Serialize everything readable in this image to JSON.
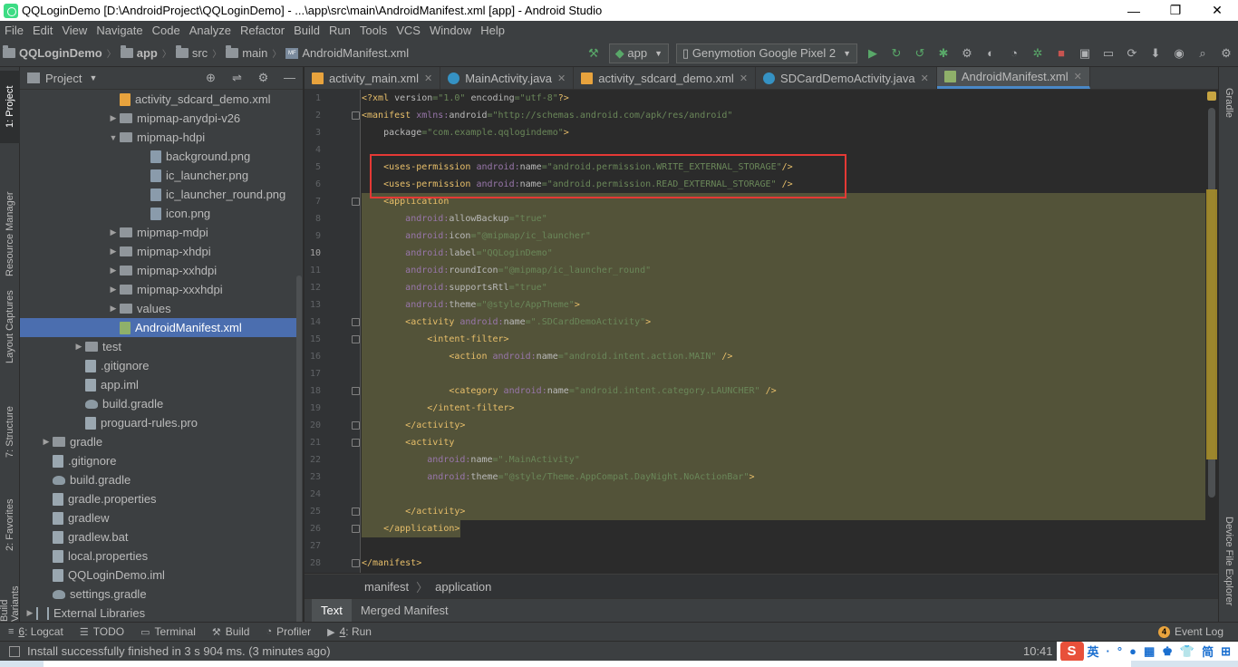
{
  "window": {
    "title": "QQLoginDemo [D:\\AndroidProject\\QQLoginDemo] - ...\\app\\src\\main\\AndroidManifest.xml [app] - Android Studio",
    "minimize": "—",
    "maximize": "❐",
    "close": "✕"
  },
  "menu": [
    "File",
    "Edit",
    "View",
    "Navigate",
    "Code",
    "Analyze",
    "Refactor",
    "Build",
    "Run",
    "Tools",
    "VCS",
    "Window",
    "Help"
  ],
  "nav": {
    "project": "QQLoginDemo",
    "module": "app",
    "src": "src",
    "main": "main",
    "file": "AndroidManifest.xml",
    "run_config": "app",
    "device": "Genymotion Google Pixel 2"
  },
  "left_stripe": {
    "project": "1: Project",
    "resource_manager": "Resource Manager",
    "layout_captures": "Layout Captures",
    "structure": "7: Structure",
    "favorites": "2: Favorites",
    "variants": "Build Variants"
  },
  "right_stripe": {
    "gradle": "Gradle",
    "device_file_explorer": "Device File Explorer"
  },
  "project_panel": {
    "title": "Project",
    "tree": [
      {
        "label": "activity_sdcard_demo.xml",
        "indent": 0,
        "icon": "xml-file-icon"
      },
      {
        "label": "mipmap-anydpi-v26",
        "indent": 0,
        "icon": "folder-icon",
        "arrow": "▶"
      },
      {
        "label": "mipmap-hdpi",
        "indent": 0,
        "icon": "folder-icon",
        "arrow": "▼"
      },
      {
        "label": "background.png",
        "indent": 1,
        "icon": "png-file-icon"
      },
      {
        "label": "ic_launcher.png",
        "indent": 1,
        "icon": "png-file-icon"
      },
      {
        "label": "ic_launcher_round.png",
        "indent": 1,
        "icon": "png-file-icon"
      },
      {
        "label": "icon.png",
        "indent": 1,
        "icon": "png-file-icon"
      },
      {
        "label": "mipmap-mdpi",
        "indent": 0,
        "icon": "folder-icon",
        "arrow": "▶"
      },
      {
        "label": "mipmap-xhdpi",
        "indent": 0,
        "icon": "folder-icon",
        "arrow": "▶"
      },
      {
        "label": "mipmap-xxhdpi",
        "indent": 0,
        "icon": "folder-icon",
        "arrow": "▶"
      },
      {
        "label": "mipmap-xxxhdpi",
        "indent": 0,
        "icon": "folder-icon",
        "arrow": "▶"
      },
      {
        "label": "values",
        "indent": 0,
        "icon": "folder-icon",
        "arrow": "▶"
      },
      {
        "label": "AndroidManifest.xml",
        "indent": -1,
        "icon": "manifest-icon",
        "selected": true
      },
      {
        "label": "test",
        "indent": -2,
        "icon": "folder-icon",
        "arrow": "▶"
      },
      {
        "label": ".gitignore",
        "indent": -2,
        "icon": "text-file-icon"
      },
      {
        "label": "app.iml",
        "indent": -2,
        "icon": "text-file-icon"
      },
      {
        "label": "build.gradle",
        "indent": -2,
        "icon": "gradle-icon"
      },
      {
        "label": "proguard-rules.pro",
        "indent": -2,
        "icon": "text-file-icon"
      },
      {
        "label": "gradle",
        "indent": -3,
        "icon": "folder-icon",
        "arrow": "▶"
      },
      {
        "label": ".gitignore",
        "indent": -3,
        "icon": "text-file-icon"
      },
      {
        "label": "build.gradle",
        "indent": -3,
        "icon": "gradle-icon"
      },
      {
        "label": "gradle.properties",
        "indent": -3,
        "icon": "text-file-icon"
      },
      {
        "label": "gradlew",
        "indent": -3,
        "icon": "text-file-icon"
      },
      {
        "label": "gradlew.bat",
        "indent": -3,
        "icon": "text-file-icon"
      },
      {
        "label": "local.properties",
        "indent": -3,
        "icon": "text-file-icon"
      },
      {
        "label": "QQLoginDemo.iml",
        "indent": -3,
        "icon": "text-file-icon"
      },
      {
        "label": "settings.gradle",
        "indent": -3,
        "icon": "gradle-icon"
      },
      {
        "label": "External Libraries",
        "indent": -4,
        "icon": "libraries-icon",
        "arrow": "▶"
      }
    ]
  },
  "editor_tabs": [
    {
      "label": "activity_main.xml",
      "icon": "xml"
    },
    {
      "label": "MainActivity.java",
      "icon": "java"
    },
    {
      "label": "activity_sdcard_demo.xml",
      "icon": "xml"
    },
    {
      "label": "SDCardDemoActivity.java",
      "icon": "java"
    },
    {
      "label": "AndroidManifest.xml",
      "icon": "mf",
      "active": true
    }
  ],
  "code": {
    "line_numbers": [
      "1",
      "2",
      "3",
      "4",
      "5",
      "6",
      "7",
      "8",
      "9",
      "10",
      "11",
      "12",
      "13",
      "14",
      "15",
      "16",
      "17",
      "18",
      "19",
      "20",
      "21",
      "22",
      "23",
      "24",
      "25",
      "26",
      "27",
      "28"
    ],
    "current_line": "10"
  },
  "breadcrumb": [
    "manifest",
    "application"
  ],
  "bottom_tabs": [
    "Text",
    "Merged Manifest"
  ],
  "tool_windows": [
    {
      "icon": "≡",
      "key": "6",
      "label": ": Logcat"
    },
    {
      "icon": "☰",
      "key": "",
      "label": "TODO"
    },
    {
      "icon": "▭",
      "key": "",
      "label": "Terminal"
    },
    {
      "icon": "⚒",
      "key": "",
      "label": "Build"
    },
    {
      "icon": "◔",
      "key": "",
      "label": "Profiler"
    },
    {
      "icon": "▶",
      "key": "4",
      "label": ": Run"
    }
  ],
  "event_log": {
    "count": "4",
    "label": "Event Log"
  },
  "status": {
    "message": "Install successfully finished in 3 s 904 ms. (3 minutes ago)",
    "time": "10:41"
  },
  "ime": [
    "S",
    "英",
    "·",
    "°",
    "●",
    "▦",
    "♚",
    "👕",
    "简",
    "⊞"
  ]
}
